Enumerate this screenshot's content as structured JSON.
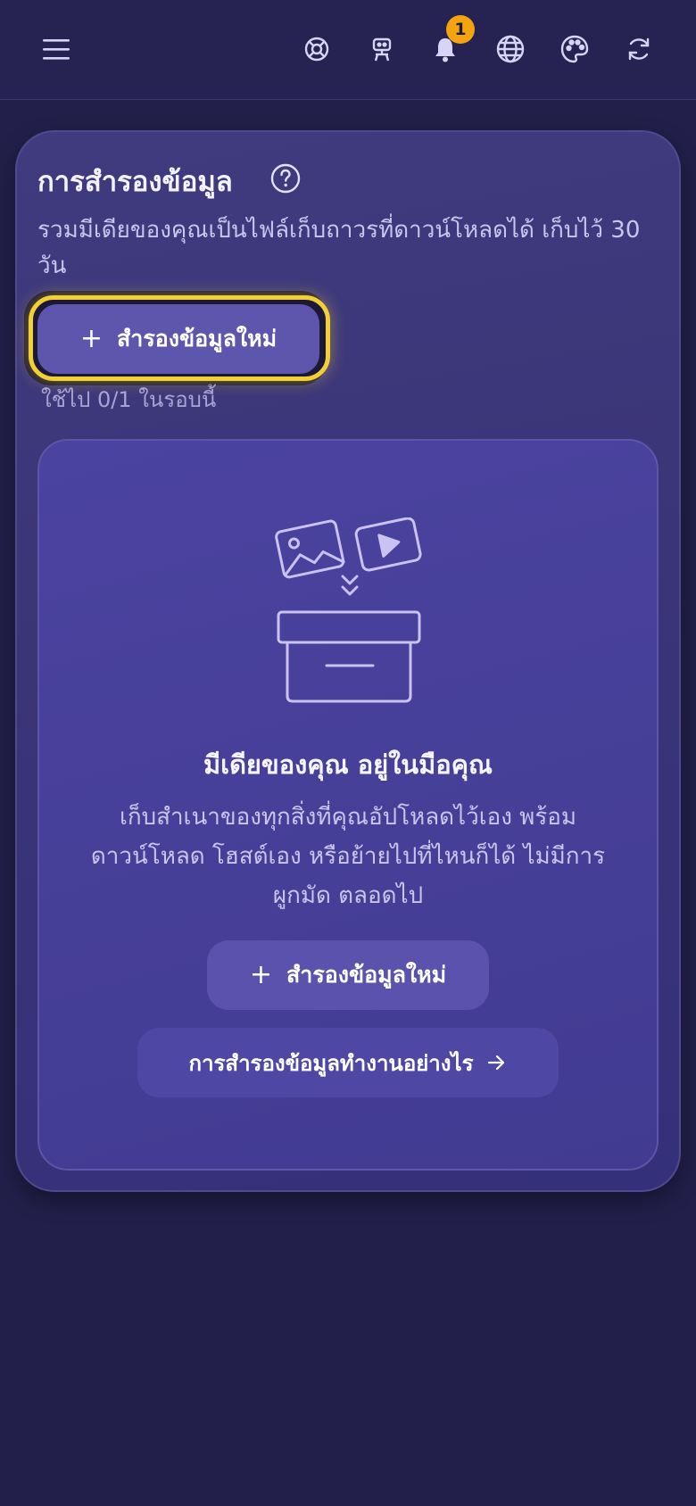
{
  "topbar": {
    "menu_icon": "hamburger-menu-icon",
    "icons": [
      "lifebuoy-icon",
      "robot-icon",
      "bell-icon",
      "globe-icon",
      "palette-icon",
      "refresh-icon"
    ],
    "notification_count": "1"
  },
  "backup_card": {
    "title": "การสำรองข้อมูล",
    "description": "รวมมีเดียของคุณเป็นไฟล์เก็บถาวรที่ดาวน์โหลดได้ เก็บไว้ 30 วัน",
    "new_backup_label": "สำรองข้อมูลใหม่",
    "usage": "ใช้ไป 0/1 ในรอบนี้"
  },
  "empty_state": {
    "title": "มีเดียของคุณ อยู่ในมือคุณ",
    "text": "เก็บสำเนาของทุกสิ่งที่คุณอัปโหลดไว้เอง พร้อมดาวน์โหลด โฮสต์เอง หรือย้ายไปที่ไหนก็ได้ ไม่มีการผูกมัด ตลอดไป",
    "new_backup_label": "สำรองข้อมูลใหม่",
    "how_it_works_label": "การสำรองข้อมูลทำงานอย่างไร"
  },
  "colors": {
    "background": "#221f4a",
    "card": "#3c3779",
    "accent_button": "#5e55ad",
    "focus_ring": "#f2cf32",
    "badge": "#f5a30f"
  }
}
